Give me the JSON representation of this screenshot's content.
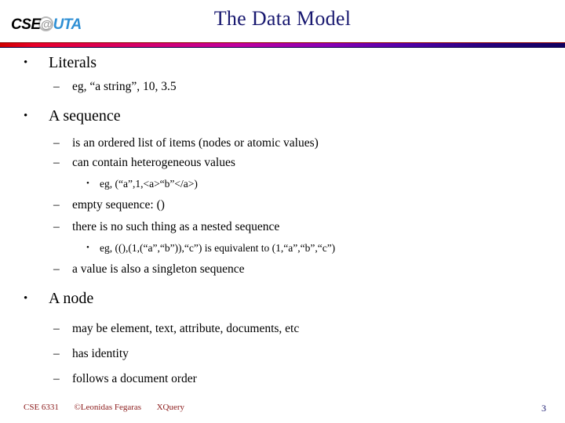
{
  "header": {
    "logo": {
      "part1": "CSE",
      "at": "@",
      "part2": "UTA",
      "alt": "CSE@UTA"
    },
    "title": "The Data Model",
    "title_color": "#191970",
    "rule_colors": [
      "#d00000",
      "#c0009e",
      "#5200a8",
      "#100060"
    ]
  },
  "outline": [
    {
      "level": 1,
      "marker": "•",
      "text": "Literals"
    },
    {
      "level": 2,
      "marker": "–",
      "text": "eg,  “a string”,  10,  3.5"
    },
    {
      "level": 1,
      "marker": "•",
      "text": "A sequence"
    },
    {
      "level": 2,
      "marker": "–",
      "text": "is an ordered list of items (nodes or atomic values)"
    },
    {
      "level": 2,
      "marker": "–",
      "text": "can contain heterogeneous values"
    },
    {
      "level": 3,
      "marker": "•",
      "text": "eg,  (“a”,1,<a>“b”</a>)"
    },
    {
      "level": 2,
      "marker": "–",
      "text": "empty sequence:  ()"
    },
    {
      "level": 2,
      "marker": "–",
      "text": "there is no such thing as a nested sequence"
    },
    {
      "level": 3,
      "marker": "•",
      "text": "eg,  ((),(1,(“a”,“b”)),“c”)    is equivalent to   (1,“a”,“b”,“c”)"
    },
    {
      "level": 2,
      "marker": "–",
      "text": "a value is also a singleton sequence"
    },
    {
      "level": 1,
      "marker": "•",
      "text": "A node"
    },
    {
      "level": 2,
      "marker": "–",
      "text": "may be element, text, attribute, documents, etc"
    },
    {
      "level": 2,
      "marker": "–",
      "text": "has identity"
    },
    {
      "level": 2,
      "marker": "–",
      "text": "follows a document order"
    }
  ],
  "footer": {
    "course": "CSE 6331",
    "copyright": "©Leonidas Fegaras",
    "topic": "XQuery",
    "page_number": "3",
    "text_color": "#8b1a1a",
    "page_color": "#191970"
  }
}
